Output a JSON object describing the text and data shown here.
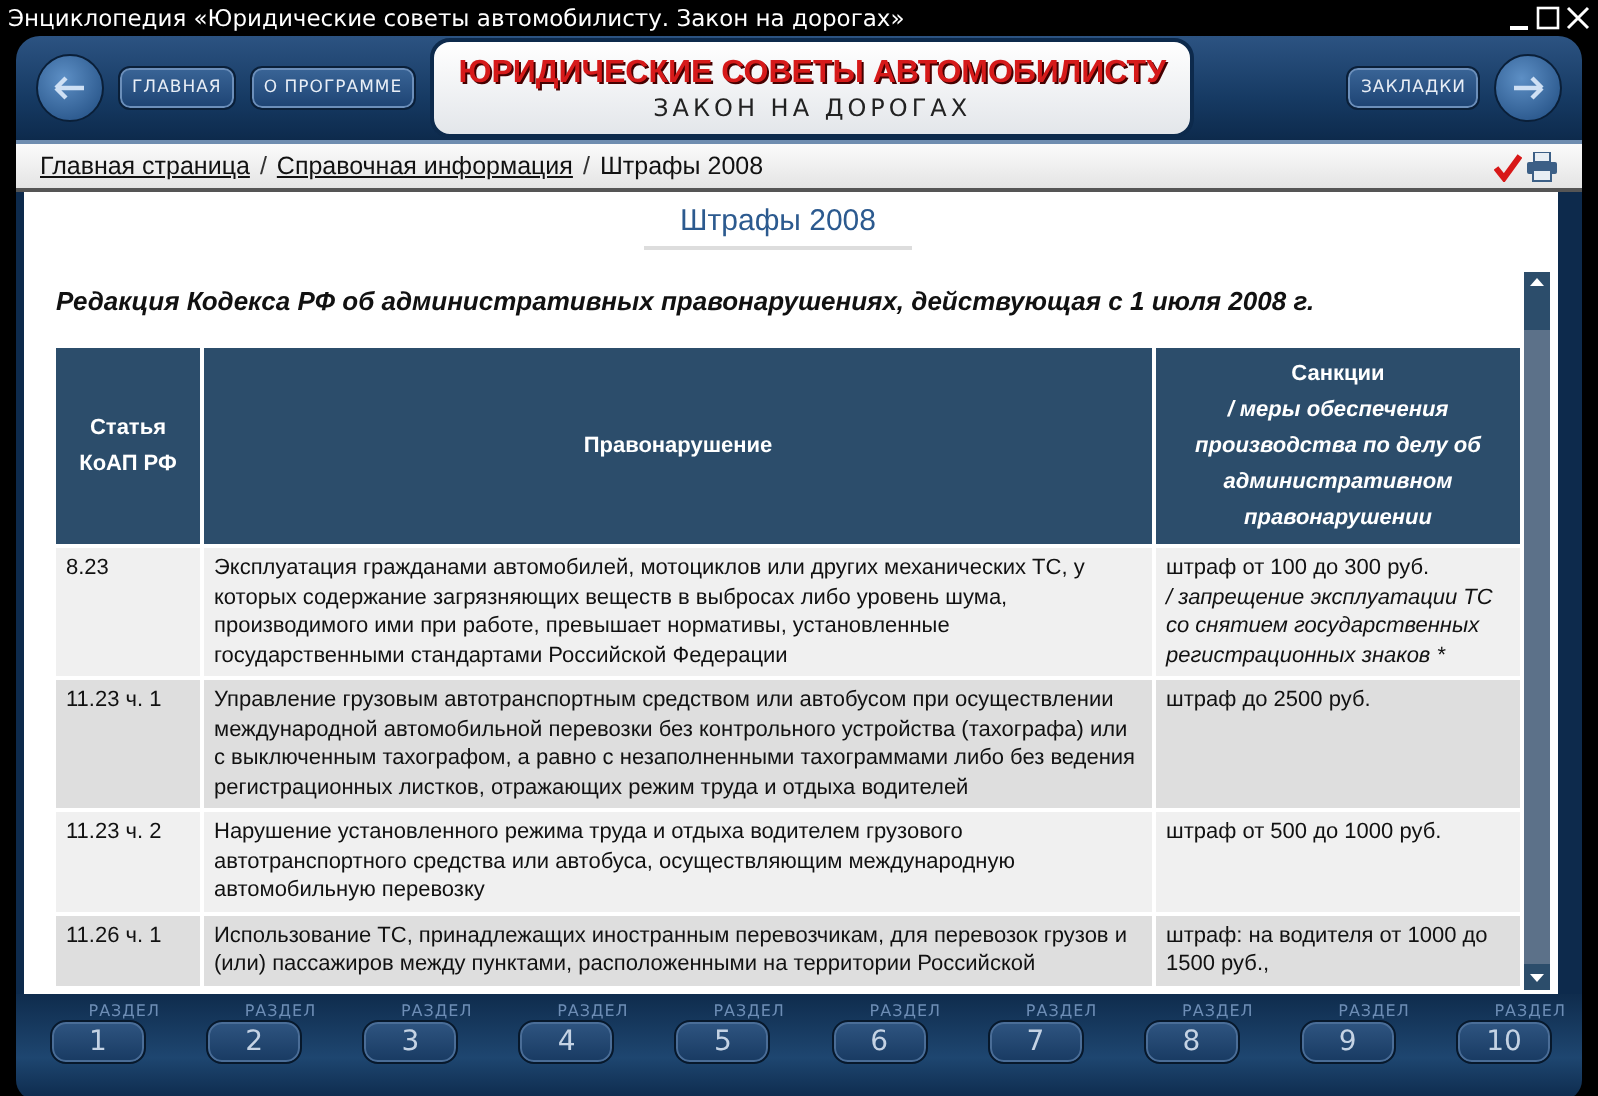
{
  "window": {
    "title": "Энциклопедия «Юридические советы автомобилисту. Закон на дорогах»"
  },
  "header": {
    "buttons": [
      "ГЛАВНАЯ",
      "О ПРОГРАММЕ"
    ],
    "logo_title": "ЮРИДИЧЕСКИЕ СОВЕТЫ АВТОМОБИЛИСТУ",
    "logo_subtitle": "ЗАКОН НА ДОРОГАХ",
    "bookmarks_button": "ЗАКЛАДКИ"
  },
  "breadcrumb_separator": "/",
  "breadcrumb": [
    {
      "label": "Главная страница",
      "kind": "link"
    },
    {
      "label": "Справочная информация",
      "kind": "link"
    },
    {
      "label": "Штрафы 2008",
      "kind": "current"
    }
  ],
  "page": {
    "title": "Штрафы 2008",
    "subtitle": "Редакция Кодекса РФ об административных правонарушениях, действующая с 1 июля 2008 г.",
    "table": {
      "columns": [
        {
          "title": "Статья КоАП РФ"
        },
        {
          "title": "Правонарушение"
        },
        {
          "title": "Санкции",
          "note": "/ меры обеспечения производства по делу об административном правонарушении"
        }
      ],
      "rows": [
        {
          "article": "8.23",
          "offense": "Эксплуатация гражданами автомобилей, мотоциклов или других механических ТС, у которых содержание загрязняющих веществ в выбросах либо уровень шума, производимого ими при работе, превышает нормативы, установленные государственными стандартами Российской Федерации",
          "sanction": "штраф от 100 до 300 руб.",
          "measure": "/ запрещение эксплуатации ТС со снятием государственных регистрационных знаков *"
        },
        {
          "article": "11.23 ч. 1",
          "offense": "Управление грузовым автотранспортным средством или автобусом при осуществлении международной автомобильной перевозки без контрольного устройства (тахографа) или с выключенным тахографом, а равно с незаполненными тахограммами либо без ведения регистрационных листков, отражающих режим труда и отдыха водителей",
          "sanction": "штраф до 2500 руб."
        },
        {
          "article": "11.23 ч. 2",
          "offense": "Нарушение установленного режима труда и отдыха водителем грузового автотранспортного средства или автобуса, осуществляющим международную автомобильную перевозку",
          "sanction": "штраф от 500 до 1000 руб."
        },
        {
          "article": "11.26 ч. 1",
          "offense": "Использование ТС, принадлежащих иностранным перевозчикам, для перевозок грузов и (или) пассажиров между пунктами, расположенными на территории Российской",
          "sanction": "штраф: на водителя от 1000 до 1500 руб.,"
        }
      ]
    }
  },
  "sections": [
    {
      "label": "РАЗДЕЛ",
      "number": "1"
    },
    {
      "label": "РАЗДЕЛ",
      "number": "2"
    },
    {
      "label": "РАЗДЕЛ",
      "number": "3"
    },
    {
      "label": "РАЗДЕЛ",
      "number": "4"
    },
    {
      "label": "РАЗДЕЛ",
      "number": "5"
    },
    {
      "label": "РАЗДЕЛ",
      "number": "6"
    },
    {
      "label": "РАЗДЕЛ",
      "number": "7"
    },
    {
      "label": "РАЗДЕЛ",
      "number": "8"
    },
    {
      "label": "РАЗДЕЛ",
      "number": "9"
    },
    {
      "label": "РАЗДЕЛ",
      "number": "10"
    }
  ]
}
